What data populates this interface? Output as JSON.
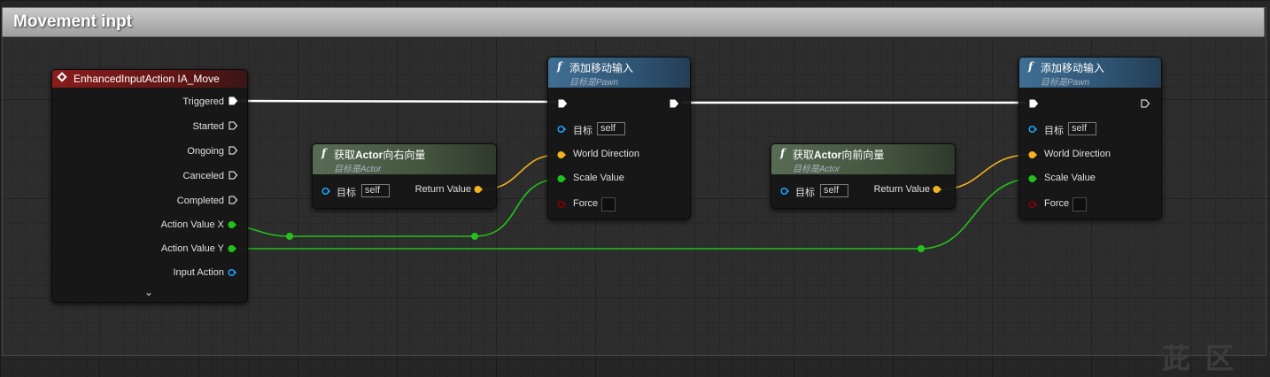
{
  "comment": {
    "title": "Movement inpt"
  },
  "colors": {
    "exec": "#ffffff",
    "float": "#23c21a",
    "vector": "#f3b21f",
    "object": "#1aa4ff",
    "bool": "#8b0000"
  },
  "event_node": {
    "title": "EnhancedInputAction IA_Move",
    "pins": [
      "Triggered",
      "Started",
      "Ongoing",
      "Canceled",
      "Completed",
      "Action Value X",
      "Action Value Y",
      "Input Action"
    ],
    "expand_icon": "chevron-down-icon"
  },
  "get_right": {
    "title_prefix": "获取",
    "title_bold": "Actor",
    "title_suffix": "向右向量",
    "subtitle": "目标是Actor",
    "target_label": "目标",
    "target_value": "self",
    "return_label": "Return Value"
  },
  "get_forward": {
    "title_prefix": "获取",
    "title_bold": "Actor",
    "title_suffix": "向前向量",
    "subtitle": "目标是Actor",
    "target_label": "目标",
    "target_value": "self",
    "return_label": "Return Value"
  },
  "add_move_1": {
    "title": "添加移动输入",
    "subtitle": "目标是Pawn",
    "target_label": "目标",
    "target_value": "self",
    "world_direction": "World Direction",
    "scale_value": "Scale Value",
    "force": "Force"
  },
  "add_move_2": {
    "title": "添加移动输入",
    "subtitle": "目标是Pawn",
    "target_label": "目标",
    "target_value": "self",
    "world_direction": "World Direction",
    "scale_value": "Scale Value",
    "force": "Force"
  },
  "watermark": "茈 区"
}
